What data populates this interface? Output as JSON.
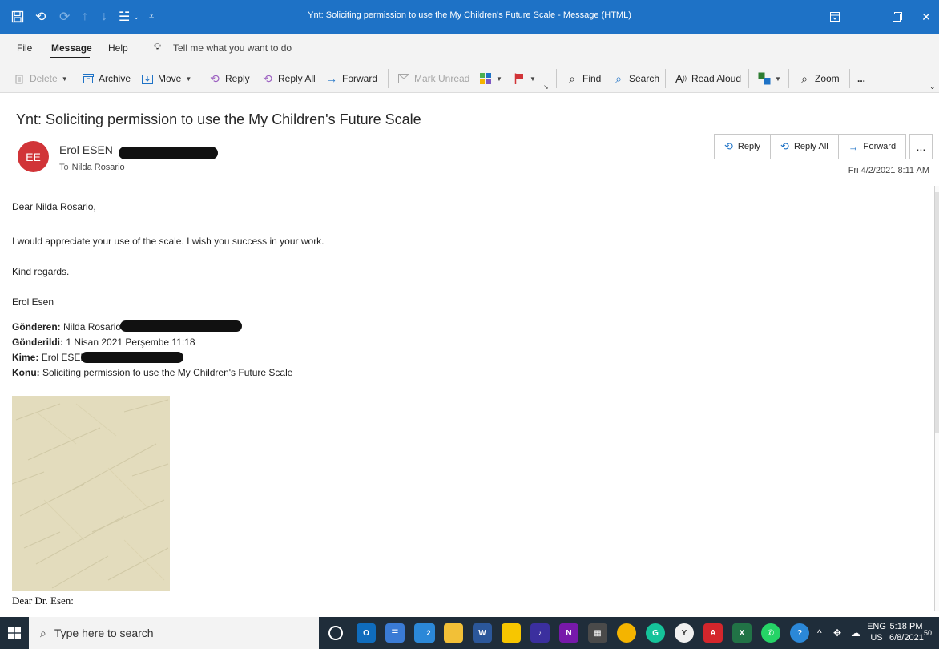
{
  "window": {
    "title": "Ynt: Soliciting permission to use the My Children's Future Scale  -  Message (HTML)"
  },
  "menu": {
    "tabs": [
      "File",
      "Message",
      "Help"
    ],
    "tell_me": "Tell me what you want to do"
  },
  "ribbon": {
    "delete": "Delete",
    "archive": "Archive",
    "move": "Move",
    "reply": "Reply",
    "reply_all": "Reply All",
    "forward": "Forward",
    "mark_unread": "Mark Unread",
    "find": "Find",
    "search": "Search",
    "read_aloud": "Read Aloud",
    "zoom": "Zoom",
    "more": "..."
  },
  "email": {
    "subject": "Ynt: Soliciting permission to use the My Children's Future Scale",
    "avatar_initials": "EE",
    "avatar_color": "#d13438",
    "sender_name": "Erol ESEN",
    "to_label": "To",
    "to_name": "Nilda Rosario",
    "date": "Fri 4/2/2021 8:11 AM",
    "actions": {
      "reply": "Reply",
      "reply_all": "Reply All",
      "forward": "Forward",
      "more": "..."
    },
    "body": [
      "Dear Nilda Rosario,",
      "I would appreciate your use of the scale. I wish you success in your work.",
      "Kind regards.",
      "Erol Esen"
    ],
    "quoted": {
      "from_label": "Gönderen:",
      "from_value": "Nilda Rosario",
      "sent_label": "Gönderildi:",
      "sent_value": "1 Nisan 2021 Perşembe 11:18",
      "to_label": "Kime:",
      "to_value": "Erol ESEN",
      "subject_label": "Konu:",
      "subject_value": "Soliciting permission to use the My Children's Future Scale",
      "greeting": "Dear Dr. Esen:"
    }
  },
  "taskbar": {
    "search_placeholder": "Type here to search",
    "badge_count": "2",
    "lang_line1": "ENG",
    "lang_line2": "US",
    "time": "5:18 PM",
    "date": "6/8/2021",
    "notification_count": "50"
  },
  "colors": {
    "title_bar": "#1e72c6",
    "accent": "#1e72c6",
    "taskbar": "#1f2d3a"
  }
}
